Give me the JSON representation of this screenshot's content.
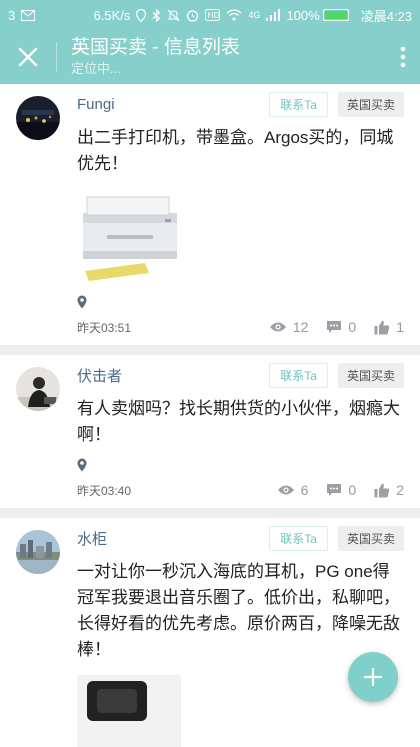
{
  "status_bar": {
    "notification_count": "3",
    "speed": "6.5K/s",
    "signal": "4G",
    "battery": "100%",
    "battery_level": 1.0,
    "time": "凌晨4:23"
  },
  "app_bar": {
    "title": "英国买卖 - 信息列表",
    "subtitle": "定位中...",
    "accent": "#86cfcb"
  },
  "posts": [
    {
      "username": "Fungi",
      "contact_label": "联系Ta",
      "tag": "英国买卖",
      "content": "出二手打印机，带墨盒。Argos买的，同城优先！",
      "has_image": true,
      "time": "昨天03:51",
      "views": "12",
      "comments": "0",
      "likes": "1"
    },
    {
      "username": "伏击者",
      "contact_label": "联系Ta",
      "tag": "英国买卖",
      "content": "有人卖烟吗？找长期供货的小伙伴，烟瘾大啊！",
      "has_image": false,
      "time": "昨天03:40",
      "views": "6",
      "comments": "0",
      "likes": "2"
    },
    {
      "username": "水柜",
      "contact_label": "联系Ta",
      "tag": "英国买卖",
      "content": "一对让你一秒沉入海底的耳机，PG one得冠军我要退出音乐圈了。低价出，私聊吧，长得好看的优先考虑。原价两百，降噪无敌棒！",
      "has_image": true
    }
  ],
  "fab_icon": "plus-icon"
}
